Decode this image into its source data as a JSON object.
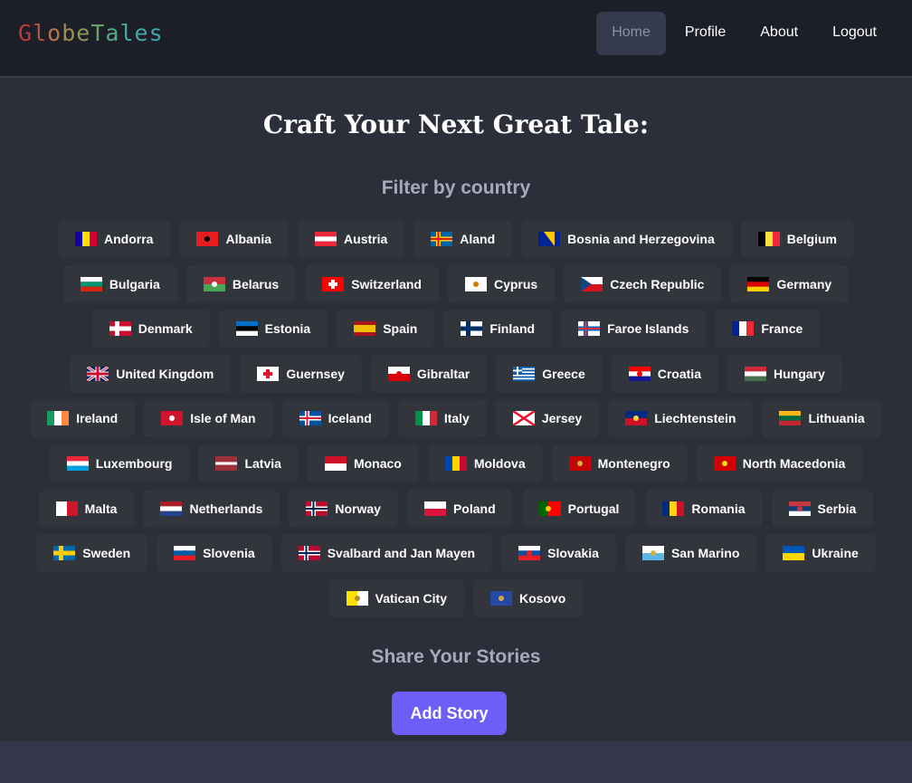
{
  "app": {
    "logo_letters": [
      {
        "ch": "G",
        "color": "#b83b3b"
      },
      {
        "ch": "l",
        "color": "#b8563f"
      },
      {
        "ch": "o",
        "color": "#b7744b"
      },
      {
        "ch": "b",
        "color": "#a08a55"
      },
      {
        "ch": "e",
        "color": "#8b9659"
      },
      {
        "ch": "T",
        "color": "#6aa06a"
      },
      {
        "ch": "a",
        "color": "#58a985"
      },
      {
        "ch": "l",
        "color": "#4aac9b"
      },
      {
        "ch": "e",
        "color": "#43a9a9"
      },
      {
        "ch": "s",
        "color": "#3ea7b3"
      }
    ]
  },
  "nav": {
    "items": [
      {
        "label": "Home",
        "active": true
      },
      {
        "label": "Profile",
        "active": false
      },
      {
        "label": "About",
        "active": false
      },
      {
        "label": "Logout",
        "active": false
      }
    ]
  },
  "main": {
    "title": "Craft Your Next Great Tale:",
    "filter_title": "Filter by country",
    "share_title": "Share Your Stories",
    "add_button": "Add Story"
  },
  "countries": [
    [
      {
        "name": "Andorra",
        "flag": {
          "dir": "v",
          "colors": [
            "#10069f",
            "#fedf00",
            "#d50032"
          ]
        }
      },
      {
        "name": "Albania",
        "flag": {
          "dir": "solid",
          "colors": [
            "#e41e20"
          ],
          "mark": "#000000"
        }
      },
      {
        "name": "Austria",
        "flag": {
          "dir": "h",
          "colors": [
            "#ed2939",
            "#ffffff",
            "#ed2939"
          ]
        }
      },
      {
        "name": "Aland",
        "flag": {
          "dir": "nordic",
          "colors": [
            "#0064ad",
            "#ffd300",
            "#da0e15"
          ]
        }
      },
      {
        "name": "Bosnia and Herzegovina",
        "flag": {
          "dir": "diag",
          "colors": [
            "#002395",
            "#fecb00"
          ]
        }
      },
      {
        "name": "Belgium",
        "flag": {
          "dir": "v",
          "colors": [
            "#000000",
            "#fae042",
            "#ed2939"
          ]
        }
      }
    ],
    [
      {
        "name": "Bulgaria",
        "flag": {
          "dir": "h",
          "colors": [
            "#ffffff",
            "#00966e",
            "#d62612"
          ]
        }
      },
      {
        "name": "Belarus",
        "flag": {
          "dir": "h2",
          "colors": [
            "#c8313e",
            "#4aa657"
          ],
          "mark": "#ffffff"
        }
      },
      {
        "name": "Switzerland",
        "flag": {
          "dir": "cross",
          "colors": [
            "#ff0000",
            "#ffffff"
          ]
        }
      },
      {
        "name": "Cyprus",
        "flag": {
          "dir": "solid",
          "colors": [
            "#ffffff"
          ],
          "mark": "#d57800"
        }
      },
      {
        "name": "Czech Republic",
        "flag": {
          "dir": "czech",
          "colors": [
            "#ffffff",
            "#d7141a",
            "#11457e"
          ]
        }
      },
      {
        "name": "Germany",
        "flag": {
          "dir": "h",
          "colors": [
            "#000000",
            "#dd0000",
            "#ffce00"
          ]
        }
      }
    ],
    [
      {
        "name": "Denmark",
        "flag": {
          "dir": "nordic",
          "colors": [
            "#c8102e",
            "#ffffff",
            "#ffffff"
          ]
        }
      },
      {
        "name": "Estonia",
        "flag": {
          "dir": "h",
          "colors": [
            "#0072ce",
            "#000000",
            "#ffffff"
          ]
        }
      },
      {
        "name": "Spain",
        "flag": {
          "dir": "spain",
          "colors": [
            "#aa151b",
            "#f1bf00",
            "#aa151b"
          ]
        }
      },
      {
        "name": "Finland",
        "flag": {
          "dir": "nordic",
          "colors": [
            "#ffffff",
            "#002f6c",
            "#002f6c"
          ]
        }
      },
      {
        "name": "Faroe Islands",
        "flag": {
          "dir": "nordic",
          "colors": [
            "#ffffff",
            "#0065bd",
            "#ef303e"
          ]
        }
      },
      {
        "name": "France",
        "flag": {
          "dir": "v",
          "colors": [
            "#002395",
            "#ffffff",
            "#ed2939"
          ]
        }
      }
    ],
    [
      {
        "name": "United Kingdom",
        "flag": {
          "dir": "uk",
          "colors": [
            "#012169",
            "#ffffff",
            "#c8102e"
          ]
        }
      },
      {
        "name": "Guernsey",
        "flag": {
          "dir": "cross",
          "colors": [
            "#ffffff",
            "#e8112d"
          ]
        }
      },
      {
        "name": "Gibraltar",
        "flag": {
          "dir": "h2",
          "colors": [
            "#ffffff",
            "#da000c"
          ],
          "mark": "#da000c"
        }
      },
      {
        "name": "Greece",
        "flag": {
          "dir": "stripes",
          "colors": [
            "#0d5eaf",
            "#ffffff"
          ]
        }
      },
      {
        "name": "Croatia",
        "flag": {
          "dir": "h",
          "colors": [
            "#ff0000",
            "#ffffff",
            "#171796"
          ],
          "mark": "#ff0000"
        }
      },
      {
        "name": "Hungary",
        "flag": {
          "dir": "h",
          "colors": [
            "#ce2939",
            "#ffffff",
            "#477050"
          ]
        }
      }
    ],
    [
      {
        "name": "Ireland",
        "flag": {
          "dir": "v",
          "colors": [
            "#169b62",
            "#ffffff",
            "#ff883e"
          ]
        }
      },
      {
        "name": "Isle of Man",
        "flag": {
          "dir": "solid",
          "colors": [
            "#cf142b"
          ],
          "mark": "#ffffff"
        }
      },
      {
        "name": "Iceland",
        "flag": {
          "dir": "nordic",
          "colors": [
            "#02529c",
            "#ffffff",
            "#dc1e35"
          ]
        }
      },
      {
        "name": "Italy",
        "flag": {
          "dir": "v",
          "colors": [
            "#009246",
            "#ffffff",
            "#ce2b37"
          ]
        }
      },
      {
        "name": "Jersey",
        "flag": {
          "dir": "saltire",
          "colors": [
            "#ffffff",
            "#e8112d"
          ]
        }
      },
      {
        "name": "Liechtenstein",
        "flag": {
          "dir": "h2",
          "colors": [
            "#002b7f",
            "#ce1126"
          ],
          "mark": "#ffd83d"
        }
      },
      {
        "name": "Lithuania",
        "flag": {
          "dir": "h",
          "colors": [
            "#fdb913",
            "#006a44",
            "#c1272d"
          ]
        }
      }
    ],
    [
      {
        "name": "Luxembourg",
        "flag": {
          "dir": "h",
          "colors": [
            "#ed2939",
            "#ffffff",
            "#00a1de"
          ]
        }
      },
      {
        "name": "Latvia",
        "flag": {
          "dir": "latvia",
          "colors": [
            "#9e3039",
            "#ffffff",
            "#9e3039"
          ]
        }
      },
      {
        "name": "Monaco",
        "flag": {
          "dir": "h2",
          "colors": [
            "#ce1126",
            "#ffffff"
          ]
        }
      },
      {
        "name": "Moldova",
        "flag": {
          "dir": "v",
          "colors": [
            "#0046ae",
            "#ffd200",
            "#cc092f"
          ]
        }
      },
      {
        "name": "Montenegro",
        "flag": {
          "dir": "solid",
          "colors": [
            "#c40308"
          ],
          "mark": "#d4af3a"
        }
      },
      {
        "name": "North Macedonia",
        "flag": {
          "dir": "solid",
          "colors": [
            "#d20000"
          ],
          "mark": "#ffe600"
        }
      }
    ],
    [
      {
        "name": "Malta",
        "flag": {
          "dir": "v2",
          "colors": [
            "#ffffff",
            "#cf142b"
          ]
        }
      },
      {
        "name": "Netherlands",
        "flag": {
          "dir": "h",
          "colors": [
            "#ae1c28",
            "#ffffff",
            "#21468b"
          ]
        }
      },
      {
        "name": "Norway",
        "flag": {
          "dir": "nordic",
          "colors": [
            "#ba0c2f",
            "#ffffff",
            "#00205b"
          ]
        }
      },
      {
        "name": "Poland",
        "flag": {
          "dir": "h2",
          "colors": [
            "#ffffff",
            "#dc143c"
          ]
        }
      },
      {
        "name": "Portugal",
        "flag": {
          "dir": "v23",
          "colors": [
            "#006600",
            "#ff0000"
          ],
          "mark": "#ffcc00"
        }
      },
      {
        "name": "Romania",
        "flag": {
          "dir": "v",
          "colors": [
            "#002b7f",
            "#fcd116",
            "#ce1126"
          ]
        }
      },
      {
        "name": "Serbia",
        "flag": {
          "dir": "h",
          "colors": [
            "#c6363c",
            "#0c4076",
            "#ffffff"
          ],
          "mark": "#c6363c"
        }
      }
    ],
    [
      {
        "name": "Sweden",
        "flag": {
          "dir": "nordic",
          "colors": [
            "#006aa7",
            "#fecc00",
            "#fecc00"
          ]
        }
      },
      {
        "name": "Slovenia",
        "flag": {
          "dir": "h",
          "colors": [
            "#ffffff",
            "#005da4",
            "#ed1c24"
          ],
          "mark": "#005da4"
        }
      },
      {
        "name": "Svalbard and Jan Mayen",
        "flag": {
          "dir": "nordic",
          "colors": [
            "#ba0c2f",
            "#ffffff",
            "#00205b"
          ]
        }
      },
      {
        "name": "Slovakia",
        "flag": {
          "dir": "h",
          "colors": [
            "#ffffff",
            "#0b4ea2",
            "#ee1c25"
          ],
          "mark": "#ee1c25"
        }
      },
      {
        "name": "San Marino",
        "flag": {
          "dir": "h2",
          "colors": [
            "#ffffff",
            "#5eb6e4"
          ],
          "mark": "#d4af3a"
        }
      },
      {
        "name": "Ukraine",
        "flag": {
          "dir": "h2",
          "colors": [
            "#0057b7",
            "#ffd700"
          ]
        }
      }
    ],
    [
      {
        "name": "Vatican City",
        "flag": {
          "dir": "v2",
          "colors": [
            "#ffe000",
            "#ffffff"
          ],
          "mark": "#b58c2b"
        }
      },
      {
        "name": "Kosovo",
        "flag": {
          "dir": "solid",
          "colors": [
            "#244aa5"
          ],
          "mark": "#d0a650"
        }
      }
    ]
  ],
  "colors": {
    "accent": "#6c5ef7",
    "chip_bg": "#33353c",
    "nav_bg": "#1c1e28",
    "page_bg": "#2c2e39"
  }
}
